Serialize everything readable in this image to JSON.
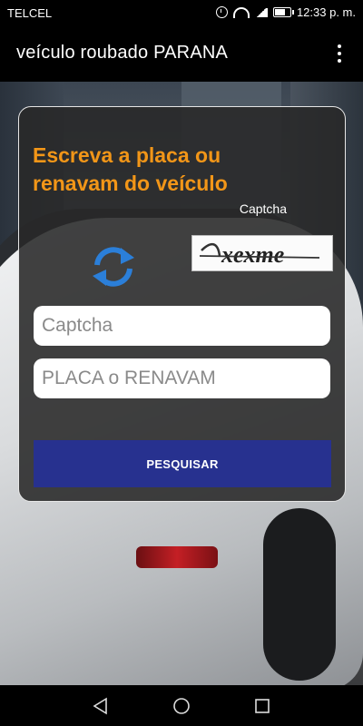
{
  "status_bar": {
    "carrier": "TELCEL",
    "time": "12:33 p. m.",
    "icons": [
      "alarm-icon",
      "wifi-icon",
      "signal-icon",
      "battery-icon"
    ]
  },
  "app_bar": {
    "title": "veículo roubado PARANA",
    "menu_icon": "overflow-menu-icon"
  },
  "form": {
    "heading": "Escreva a placa ou renavam do veículo",
    "captcha_label": "Captcha",
    "captcha_image_text": "xexme",
    "refresh_icon": "refresh-icon",
    "captcha_input": {
      "placeholder": "Captcha",
      "value": ""
    },
    "plate_input": {
      "placeholder": "PLACA o RENAVAM",
      "value": ""
    },
    "search_button": "PESQUISAR"
  },
  "nav_bar": {
    "buttons": [
      "back-icon",
      "home-icon",
      "recents-icon"
    ]
  },
  "colors": {
    "heading": "#f29618",
    "button": "#27318f",
    "refresh": "#2b7fd9",
    "card_bg": "#282828"
  }
}
